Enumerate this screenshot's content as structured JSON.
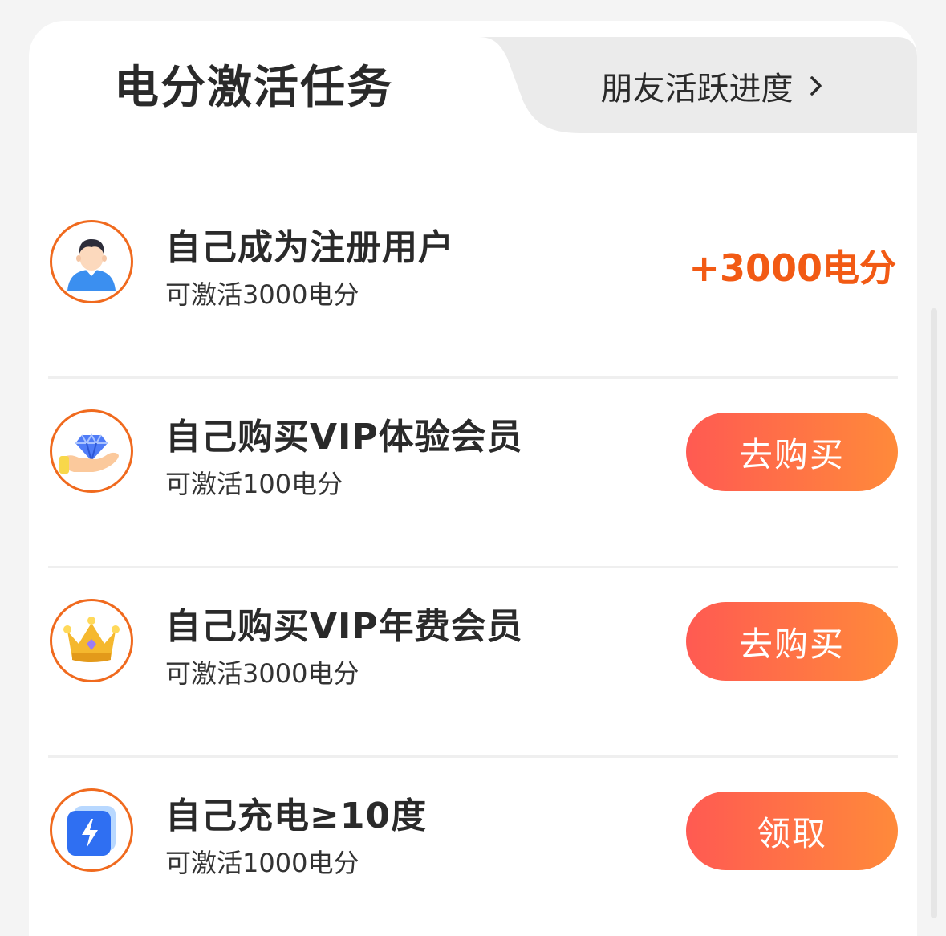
{
  "tabs": {
    "active": "电分激活任务",
    "inactive": "朋友活跃进度"
  },
  "tasks": [
    {
      "title": "自己成为注册用户",
      "subtitle": "可激活3000电分",
      "icon": "user-avatar-icon",
      "reward": "+3000电分"
    },
    {
      "title": "自己购买VIP体验会员",
      "subtitle": "可激活100电分",
      "icon": "diamond-hand-icon",
      "button": "去购买"
    },
    {
      "title": "自己购买VIP年费会员",
      "subtitle": "可激活3000电分",
      "icon": "crown-icon",
      "button": "去购买"
    },
    {
      "title": "自己充电≥10度",
      "subtitle": "可激活1000电分",
      "icon": "lightning-charge-icon",
      "button": "领取"
    }
  ],
  "colors": {
    "accent": "#f25a14",
    "button_start": "#ff5a52",
    "button_end": "#ff8a3a",
    "icon_ring": "#f06a1e"
  }
}
